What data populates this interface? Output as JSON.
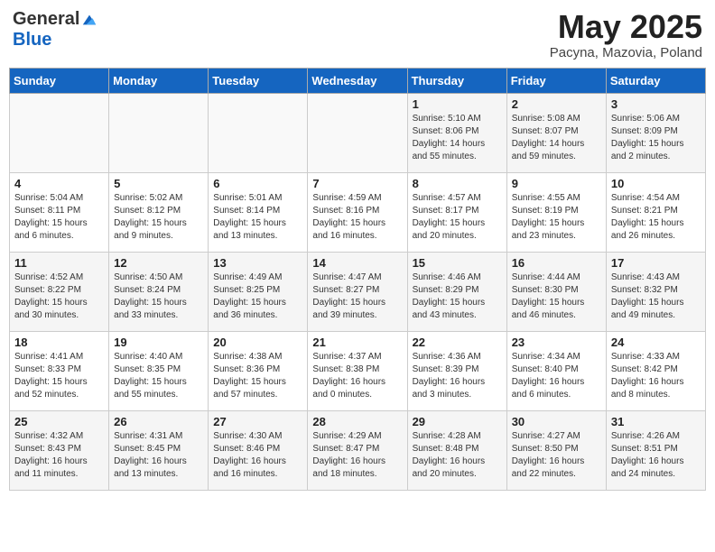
{
  "header": {
    "logo_general": "General",
    "logo_blue": "Blue",
    "month_title": "May 2025",
    "subtitle": "Pacyna, Mazovia, Poland"
  },
  "days_of_week": [
    "Sunday",
    "Monday",
    "Tuesday",
    "Wednesday",
    "Thursday",
    "Friday",
    "Saturday"
  ],
  "weeks": [
    [
      {
        "day": "",
        "info": ""
      },
      {
        "day": "",
        "info": ""
      },
      {
        "day": "",
        "info": ""
      },
      {
        "day": "",
        "info": ""
      },
      {
        "day": "1",
        "info": "Sunrise: 5:10 AM\nSunset: 8:06 PM\nDaylight: 14 hours\nand 55 minutes."
      },
      {
        "day": "2",
        "info": "Sunrise: 5:08 AM\nSunset: 8:07 PM\nDaylight: 14 hours\nand 59 minutes."
      },
      {
        "day": "3",
        "info": "Sunrise: 5:06 AM\nSunset: 8:09 PM\nDaylight: 15 hours\nand 2 minutes."
      }
    ],
    [
      {
        "day": "4",
        "info": "Sunrise: 5:04 AM\nSunset: 8:11 PM\nDaylight: 15 hours\nand 6 minutes."
      },
      {
        "day": "5",
        "info": "Sunrise: 5:02 AM\nSunset: 8:12 PM\nDaylight: 15 hours\nand 9 minutes."
      },
      {
        "day": "6",
        "info": "Sunrise: 5:01 AM\nSunset: 8:14 PM\nDaylight: 15 hours\nand 13 minutes."
      },
      {
        "day": "7",
        "info": "Sunrise: 4:59 AM\nSunset: 8:16 PM\nDaylight: 15 hours\nand 16 minutes."
      },
      {
        "day": "8",
        "info": "Sunrise: 4:57 AM\nSunset: 8:17 PM\nDaylight: 15 hours\nand 20 minutes."
      },
      {
        "day": "9",
        "info": "Sunrise: 4:55 AM\nSunset: 8:19 PM\nDaylight: 15 hours\nand 23 minutes."
      },
      {
        "day": "10",
        "info": "Sunrise: 4:54 AM\nSunset: 8:21 PM\nDaylight: 15 hours\nand 26 minutes."
      }
    ],
    [
      {
        "day": "11",
        "info": "Sunrise: 4:52 AM\nSunset: 8:22 PM\nDaylight: 15 hours\nand 30 minutes."
      },
      {
        "day": "12",
        "info": "Sunrise: 4:50 AM\nSunset: 8:24 PM\nDaylight: 15 hours\nand 33 minutes."
      },
      {
        "day": "13",
        "info": "Sunrise: 4:49 AM\nSunset: 8:25 PM\nDaylight: 15 hours\nand 36 minutes."
      },
      {
        "day": "14",
        "info": "Sunrise: 4:47 AM\nSunset: 8:27 PM\nDaylight: 15 hours\nand 39 minutes."
      },
      {
        "day": "15",
        "info": "Sunrise: 4:46 AM\nSunset: 8:29 PM\nDaylight: 15 hours\nand 43 minutes."
      },
      {
        "day": "16",
        "info": "Sunrise: 4:44 AM\nSunset: 8:30 PM\nDaylight: 15 hours\nand 46 minutes."
      },
      {
        "day": "17",
        "info": "Sunrise: 4:43 AM\nSunset: 8:32 PM\nDaylight: 15 hours\nand 49 minutes."
      }
    ],
    [
      {
        "day": "18",
        "info": "Sunrise: 4:41 AM\nSunset: 8:33 PM\nDaylight: 15 hours\nand 52 minutes."
      },
      {
        "day": "19",
        "info": "Sunrise: 4:40 AM\nSunset: 8:35 PM\nDaylight: 15 hours\nand 55 minutes."
      },
      {
        "day": "20",
        "info": "Sunrise: 4:38 AM\nSunset: 8:36 PM\nDaylight: 15 hours\nand 57 minutes."
      },
      {
        "day": "21",
        "info": "Sunrise: 4:37 AM\nSunset: 8:38 PM\nDaylight: 16 hours\nand 0 minutes."
      },
      {
        "day": "22",
        "info": "Sunrise: 4:36 AM\nSunset: 8:39 PM\nDaylight: 16 hours\nand 3 minutes."
      },
      {
        "day": "23",
        "info": "Sunrise: 4:34 AM\nSunset: 8:40 PM\nDaylight: 16 hours\nand 6 minutes."
      },
      {
        "day": "24",
        "info": "Sunrise: 4:33 AM\nSunset: 8:42 PM\nDaylight: 16 hours\nand 8 minutes."
      }
    ],
    [
      {
        "day": "25",
        "info": "Sunrise: 4:32 AM\nSunset: 8:43 PM\nDaylight: 16 hours\nand 11 minutes."
      },
      {
        "day": "26",
        "info": "Sunrise: 4:31 AM\nSunset: 8:45 PM\nDaylight: 16 hours\nand 13 minutes."
      },
      {
        "day": "27",
        "info": "Sunrise: 4:30 AM\nSunset: 8:46 PM\nDaylight: 16 hours\nand 16 minutes."
      },
      {
        "day": "28",
        "info": "Sunrise: 4:29 AM\nSunset: 8:47 PM\nDaylight: 16 hours\nand 18 minutes."
      },
      {
        "day": "29",
        "info": "Sunrise: 4:28 AM\nSunset: 8:48 PM\nDaylight: 16 hours\nand 20 minutes."
      },
      {
        "day": "30",
        "info": "Sunrise: 4:27 AM\nSunset: 8:50 PM\nDaylight: 16 hours\nand 22 minutes."
      },
      {
        "day": "31",
        "info": "Sunrise: 4:26 AM\nSunset: 8:51 PM\nDaylight: 16 hours\nand 24 minutes."
      }
    ]
  ]
}
